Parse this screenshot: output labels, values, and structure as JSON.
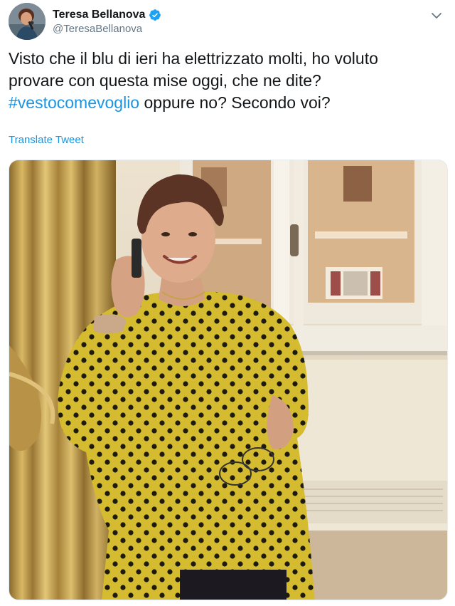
{
  "author": {
    "display_name": "Teresa Bellanova",
    "handle": "@TeresaBellanova",
    "verified": true,
    "avatar_icon": "profile-avatar"
  },
  "tweet": {
    "text_line1": "Visto che il blu di ieri ha elettrizzato molti, ho voluto",
    "text_line2": "provare con questa mise oggi, che ne dite?",
    "hashtag": "#vestocomevoglio",
    "text_line3_rest": " oppure no? Secondo voi?",
    "translate_label": "Translate Tweet"
  },
  "media": {
    "icon": "photo-woman-polka-dot-dress-on-phone"
  },
  "colors": {
    "link": "#1b95e0",
    "text": "#14171a",
    "secondary": "#657786",
    "verified": "#1da1f2"
  }
}
